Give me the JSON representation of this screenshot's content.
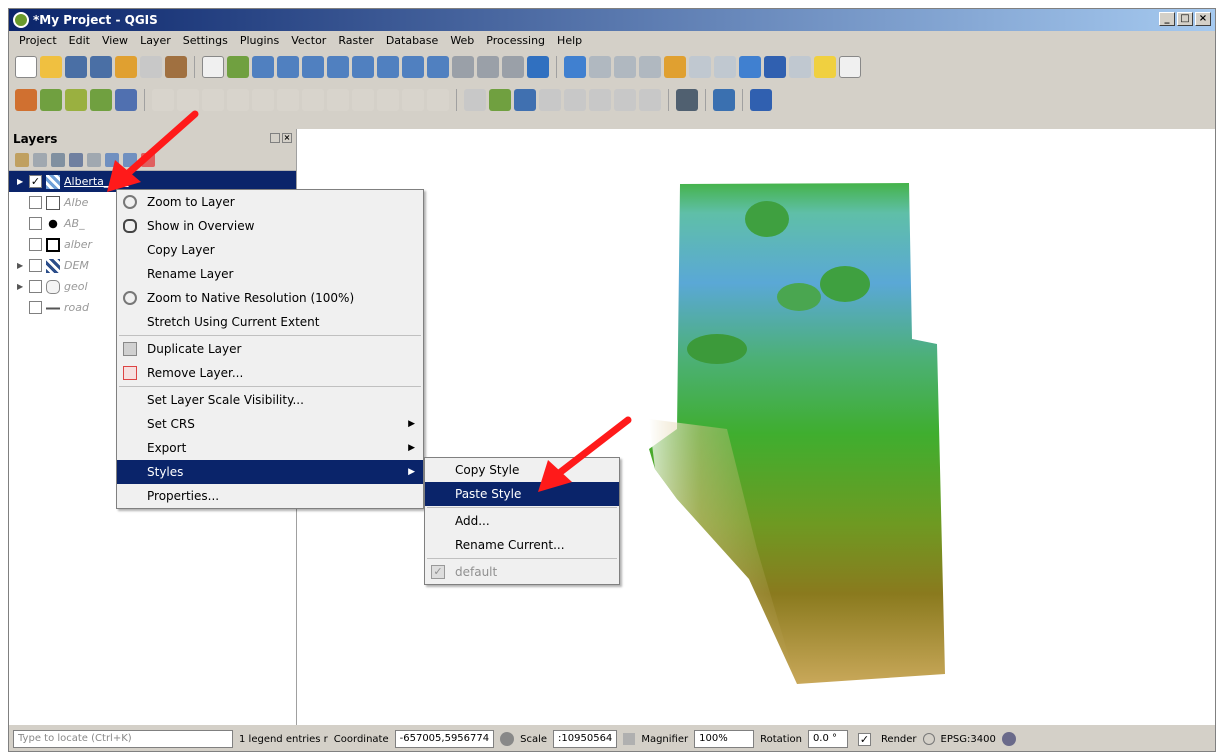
{
  "window": {
    "title": "*My Project - QGIS",
    "controls": [
      "_",
      "□",
      "×"
    ]
  },
  "menubar": [
    "Project",
    "Edit",
    "View",
    "Layer",
    "Settings",
    "Plugins",
    "Vector",
    "Raster",
    "Database",
    "Web",
    "Processing",
    "Help"
  ],
  "layers_panel": {
    "title": "Layers",
    "layers": [
      {
        "name": "Alberta_clip",
        "checked": true,
        "selected": true
      },
      {
        "name": "Albe",
        "checked": false
      },
      {
        "name": "AB_",
        "checked": false
      },
      {
        "name": "alber",
        "checked": false
      },
      {
        "name": "DEM",
        "checked": false
      },
      {
        "name": "geol",
        "checked": false
      },
      {
        "name": "road",
        "checked": false
      }
    ]
  },
  "context_menu": {
    "items": [
      "Zoom to Layer",
      "Show in Overview",
      "Copy Layer",
      "Rename Layer",
      "Zoom to Native Resolution (100%)",
      "Stretch Using Current Extent",
      "Duplicate Layer",
      "Remove Layer...",
      "Set Layer Scale Visibility...",
      "Set CRS",
      "Export",
      "Styles",
      "Properties..."
    ]
  },
  "styles_submenu": {
    "items": [
      "Copy Style",
      "Paste Style",
      "Add...",
      "Rename Current...",
      "default"
    ]
  },
  "statusbar": {
    "locate_placeholder": "Type to locate (Ctrl+K)",
    "legend_text": "1 legend entries r",
    "coordinate_label": "Coordinate",
    "coordinate": "-657005,5956774",
    "scale_label": "Scale",
    "scale": ":10950564",
    "magnifier_label": "Magnifier",
    "magnifier": "100%",
    "rotation_label": "Rotation",
    "rotation": "0.0 °",
    "render_label": "Render",
    "crs": "EPSG:3400"
  },
  "colors": {
    "selection": "#0a246a",
    "dem_low": "#5aa8d6",
    "dem_mid": "#3fae2f",
    "dem_high": "#8a7a1e",
    "annotation": "#ff1a1a"
  }
}
